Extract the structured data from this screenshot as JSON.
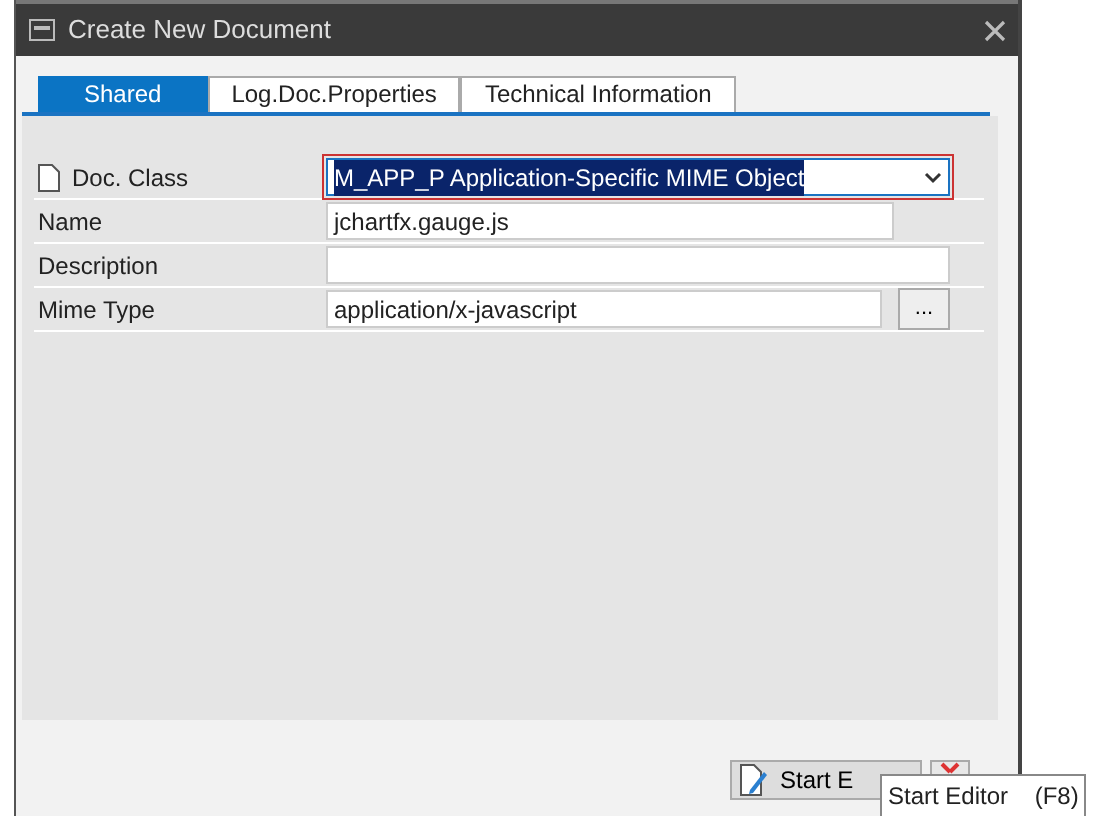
{
  "window": {
    "title": "Create New Document"
  },
  "tabs": [
    {
      "label": "Shared",
      "selected": true
    },
    {
      "label": "Log.Doc.Properties",
      "selected": false
    },
    {
      "label": "Technical Information",
      "selected": false
    }
  ],
  "fields": [
    {
      "kind": "dropdown",
      "label": "Doc. Class",
      "value": "M_APP_P Application-Specific MIME Object",
      "focused": true
    },
    {
      "kind": "text",
      "label": "Name",
      "value": "jchartfx.gauge.js"
    },
    {
      "kind": "text",
      "label": "Description"
    },
    {
      "kind": "browse",
      "label": "Mime Type",
      "value": "application/x-javascript",
      "button": "..."
    }
  ],
  "buttons": [
    {
      "kind": "editor",
      "label": "Start E"
    },
    {
      "kind": "cancel"
    }
  ],
  "tooltip": "Start Editor    (F8)"
}
